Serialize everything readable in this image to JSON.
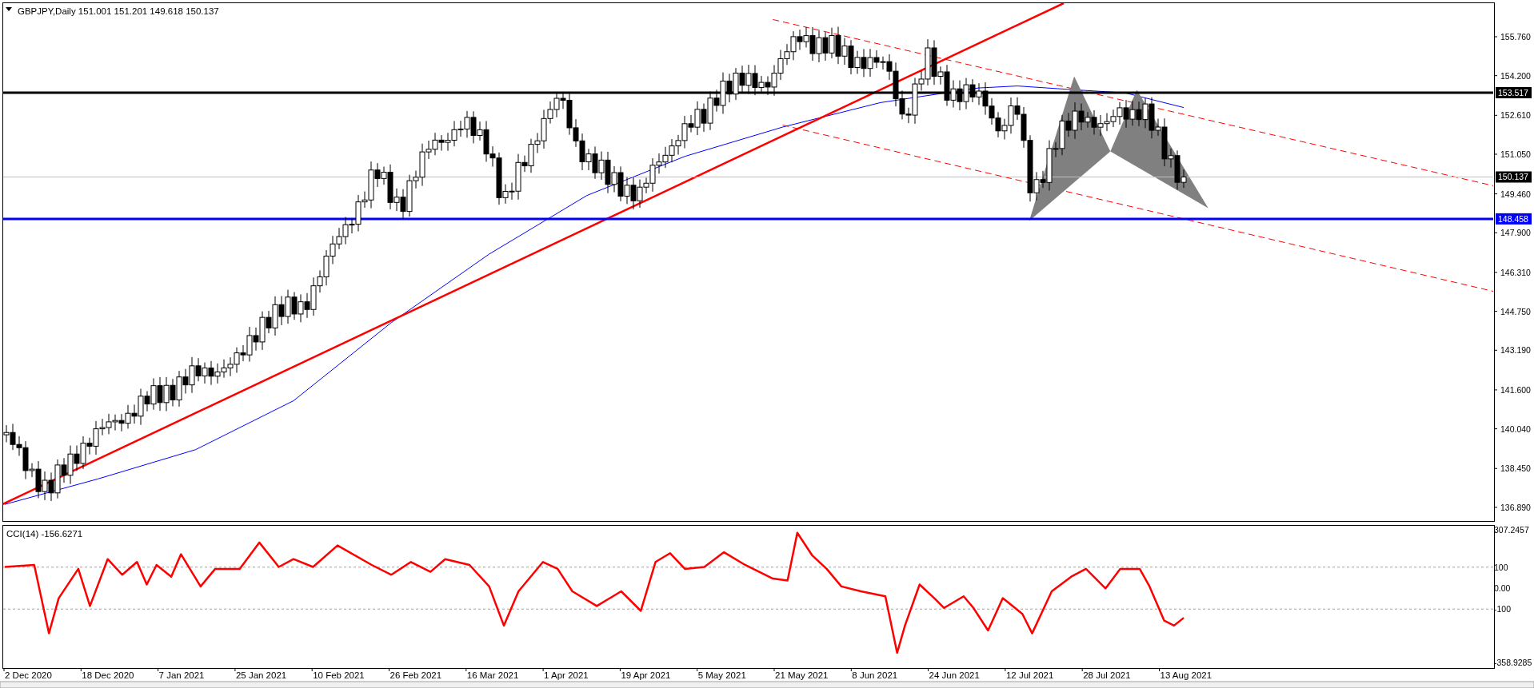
{
  "chart_header": {
    "symbol": "GBPJPY,Daily",
    "ohlc": [
      "151.001",
      "151.201",
      "149.618",
      "150.137"
    ]
  },
  "price_axis": {
    "labels": [
      "155.760",
      "154.200",
      "152.610",
      "151.050",
      "149.460",
      "147.900",
      "146.310",
      "144.750",
      "143.190",
      "141.600",
      "140.040",
      "138.450",
      "136.890"
    ]
  },
  "price_levels": [
    {
      "label": "153.517",
      "kind": "horizontal-line",
      "color": "#000000"
    },
    {
      "label": "150.137",
      "kind": "bid",
      "color": "#000000"
    },
    {
      "label": "148.458",
      "kind": "horizontal-line",
      "color": "#0000ff"
    }
  ],
  "indicator": {
    "title": "CCI(14) -156.6271",
    "axis_labels": [
      "307.2457",
      "100",
      "0.00",
      "-100",
      "-358.9285"
    ]
  },
  "time_axis": {
    "labels": [
      "2 Dec 2020",
      "18 Dec 2020",
      "7 Jan 2021",
      "25 Jan 2021",
      "10 Feb 2021",
      "26 Feb 2021",
      "16 Mar 2021",
      "1 Apr 2021",
      "19 Apr 2021",
      "5 May 2021",
      "21 May 2021",
      "8 Jun 2021",
      "24 Jun 2021",
      "12 Jul 2021",
      "28 Jul 2021",
      "13 Aug 2021"
    ]
  }
}
